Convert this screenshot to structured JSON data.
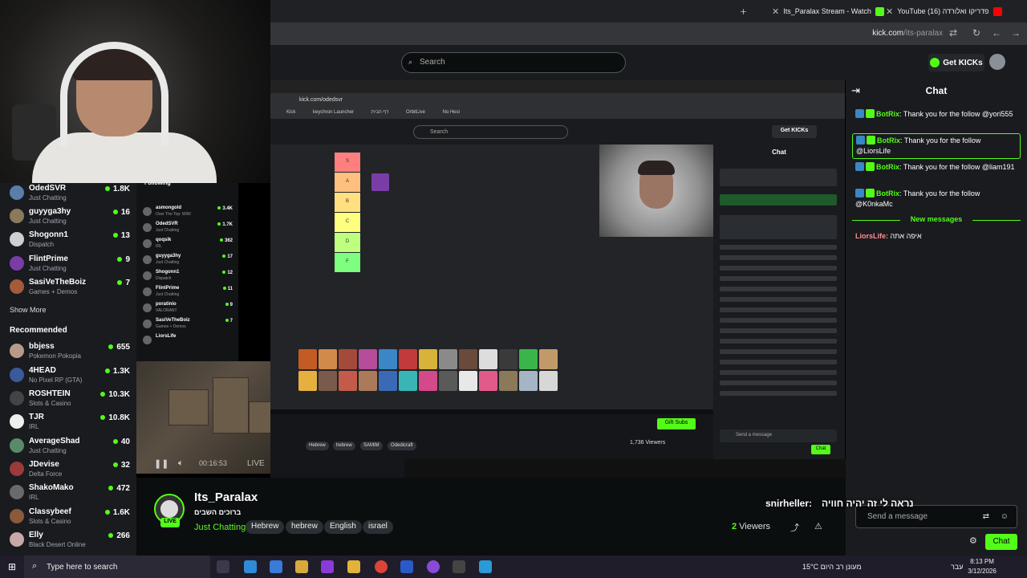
{
  "browser": {
    "tabs": [
      {
        "label": "Its_Paralax Stream - Watch"
      },
      {
        "label": "YouTube (16) פדריקו ואלורדה"
      }
    ],
    "url_host": "kick.com",
    "url_path": "/its-paralax"
  },
  "header": {
    "search_placeholder": "Search",
    "get_kicks": "Get KICKs"
  },
  "sidebar": {
    "following": [
      {
        "name": "OdedSVR",
        "sub": "Just Chatting",
        "viewers": "1.8K",
        "color": "#5b7ea8"
      },
      {
        "name": "guyyga3hy",
        "sub": "Just Chatting",
        "viewers": "16",
        "color": "#8a7a5a"
      },
      {
        "name": "Shogonn1",
        "sub": "Dispatch",
        "viewers": "13",
        "color": "#cfcfcf"
      },
      {
        "name": "FlintPrime",
        "sub": "Just Chatting",
        "viewers": "9",
        "color": "#7a3da8"
      },
      {
        "name": "SasiVeTheBoiz",
        "sub": "Games + Demos",
        "viewers": "7",
        "color": "#a55a3a"
      }
    ],
    "show_more": "Show More",
    "recommended_title": "Recommended",
    "recommended": [
      {
        "name": "bbjess",
        "sub": "Pokemon Pokopia",
        "viewers": "655",
        "color": "#b89a8a"
      },
      {
        "name": "4HEAD",
        "sub": "No Pixel RP (GTA)",
        "viewers": "1.3K",
        "color": "#3a5a9a"
      },
      {
        "name": "ROSHTEIN",
        "sub": "Slots & Casino",
        "viewers": "10.3K",
        "color": "#444444"
      },
      {
        "name": "TJR",
        "sub": "IRL",
        "viewers": "10.8K",
        "color": "#eeeeee"
      },
      {
        "name": "AverageShad",
        "sub": "Just Chatting",
        "viewers": "40",
        "color": "#5a8a6a"
      },
      {
        "name": "JDevise",
        "sub": "Delta Force",
        "viewers": "32",
        "color": "#9a3a3a"
      },
      {
        "name": "ShakoMako",
        "sub": "IRL",
        "viewers": "472",
        "color": "#6a6a6a"
      },
      {
        "name": "Classybeef",
        "sub": "Slots & Casino",
        "viewers": "1.6K",
        "color": "#8a5a3a"
      },
      {
        "name": "Elly",
        "sub": "Black Desert Online",
        "viewers": "266",
        "color": "#c8a8a8"
      }
    ]
  },
  "inner": {
    "url": "kick.com/odedsvr",
    "bookmarks": [
      "Kick",
      "keychron Launcher",
      "דף הבית",
      "OrbitLive",
      "No Hesi"
    ],
    "search": "Search",
    "get_kicks": "Get KICKs",
    "chat": "Chat",
    "following": "Following",
    "send_message": "Send a message",
    "chat_btn": "Chat",
    "gift_subs": "Gift Subs",
    "viewers": "1,736 Viewers",
    "tags": [
      "Hebrew",
      "hebrew",
      "SAMIM",
      "Odedicraft"
    ],
    "list": [
      {
        "name": "asmongold",
        "sub": "Over The Top: WWI",
        "viewers": "3.4K"
      },
      {
        "name": "OdedSVR",
        "sub": "Just Chatting",
        "viewers": "1.7K"
      },
      {
        "name": "qoqsik",
        "sub": "IRL",
        "viewers": "362"
      },
      {
        "name": "guyyga3hy",
        "sub": "Just Chatting",
        "viewers": "17"
      },
      {
        "name": "Shogonn1",
        "sub": "Dispatch",
        "viewers": "12"
      },
      {
        "name": "FlintPrime",
        "sub": "Just Chatting",
        "viewers": "11"
      },
      {
        "name": "poratinio",
        "sub": "VALORANT",
        "viewers": "9"
      },
      {
        "name": "SasiVeTheBoiz",
        "sub": "Games + Demos",
        "viewers": "7"
      },
      {
        "name": "LiorsLife",
        "sub": "",
        "viewers": ""
      }
    ],
    "tiers": [
      {
        "label": "S",
        "color": "#ff7f7f"
      },
      {
        "label": "A",
        "color": "#ffbf7f"
      },
      {
        "label": "B",
        "color": "#ffdf7f"
      },
      {
        "label": "C",
        "color": "#ffff7f"
      },
      {
        "label": "D",
        "color": "#bfff7f"
      },
      {
        "label": "F",
        "color": "#7fff7f"
      }
    ]
  },
  "player": {
    "time": "00:16:53",
    "live": "LIVE"
  },
  "stream": {
    "channel": "Its_Paralax",
    "title": "ברוכים השבים",
    "category": "Just Chatting",
    "tags": [
      "Hebrew",
      "hebrew",
      "English",
      "israel"
    ],
    "viewers_count": "2",
    "viewers_label": "Viewers",
    "live": "LIVE"
  },
  "chat": {
    "title": "Chat",
    "messages": [
      {
        "user": "BotRix",
        "text": "Thank you for the follow @yori555"
      },
      {
        "user": "BotRix",
        "text": "Thank you for the follow @LiorsLife"
      },
      {
        "user": "BotRix",
        "text": "Thank you for the follow @liam191"
      },
      {
        "user": "BotRix",
        "text": "Thank you for the follow @K0nkaMc"
      }
    ],
    "new_messages": "New messages",
    "last_user": "LiorsLife:",
    "last_text": "איפה אתה",
    "overlay_user": "snirheller:",
    "overlay_text": "נראה לי זה יהיה חוויה",
    "input_placeholder": "Send a message",
    "send_label": "Chat"
  },
  "taskbar": {
    "search": "Type here to search",
    "weather": "15°C  מעונן רב היום",
    "lang": "עבר",
    "time": "8:13 PM",
    "date": "3/12/2026"
  }
}
